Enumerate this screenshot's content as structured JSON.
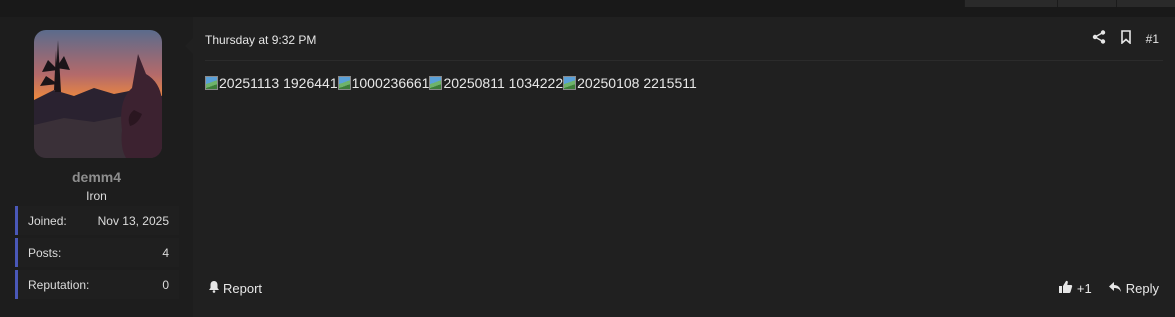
{
  "user": {
    "name": "demm4",
    "title": "Iron",
    "stats": [
      {
        "key": "Joined:",
        "value": "Nov 13, 2025"
      },
      {
        "key": "Posts:",
        "value": "4"
      },
      {
        "key": "Reputation:",
        "value": "0"
      }
    ],
    "accent_color": "#4a58b8"
  },
  "post": {
    "date": "Thursday at 9:32 PM",
    "number": "#1",
    "images": [
      {
        "alt": "20251113 1926441"
      },
      {
        "alt": "1000236661"
      },
      {
        "alt": "20250811 1034222"
      },
      {
        "alt": "20250108 2215511"
      }
    ]
  },
  "actions": {
    "share_icon": "share-icon",
    "bookmark_icon": "bookmark-icon",
    "report_label": "Report",
    "like_count": "+1",
    "reply_label": "Reply"
  }
}
